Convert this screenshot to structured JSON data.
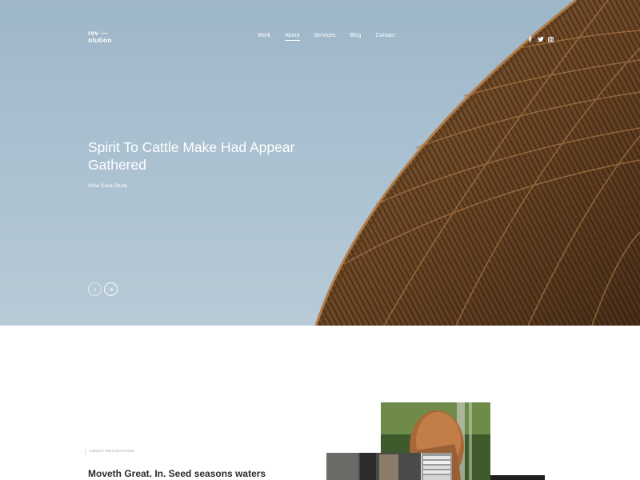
{
  "brand": {
    "logo_line1": "rev —",
    "logo_line2": "olution"
  },
  "nav": {
    "items": [
      {
        "label": "Work"
      },
      {
        "label": "About"
      },
      {
        "label": "Services"
      },
      {
        "label": "Blog"
      },
      {
        "label": "Contact"
      }
    ],
    "active": "About"
  },
  "social": {
    "icons": [
      "facebook-icon",
      "twitter-icon",
      "instagram-icon"
    ]
  },
  "hero": {
    "headline": "Spirit To Cattle Make Had Appear Gathered",
    "link_label": "View Case Study",
    "prev_icon": "arrow-left-icon",
    "next_icon": "arrow-right-icon"
  },
  "about": {
    "eyebrow": "ABOUT REVOLUTION",
    "title": "Moveth Great. In. Seed seasons waters"
  },
  "colors": {
    "sky": "#a9c0d0",
    "wood": "#7a5330",
    "text_light": "#ffffff",
    "text_dark": "#2a2a2a"
  }
}
